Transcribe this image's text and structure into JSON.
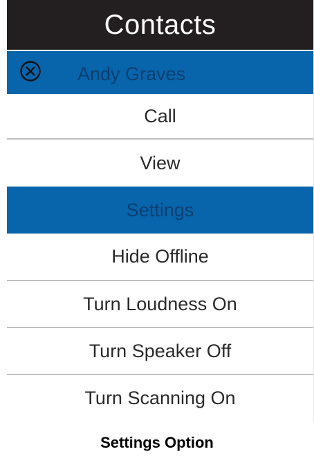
{
  "header": {
    "title": "Contacts"
  },
  "contact": {
    "name": "Andy Graves",
    "icon": "cancel-circle-icon"
  },
  "menu": {
    "call": "Call",
    "view": "View",
    "settings": "Settings",
    "hide_offline": "Hide Offline",
    "loudness": "Turn Loudness On",
    "speaker": "Turn Speaker Off",
    "scanning": "Turn Scanning On"
  },
  "caption": "Settings Option",
  "colors": {
    "header_bg": "#231f20",
    "selected_bg": "#0864ab",
    "selected_text": "#0d3f70"
  }
}
